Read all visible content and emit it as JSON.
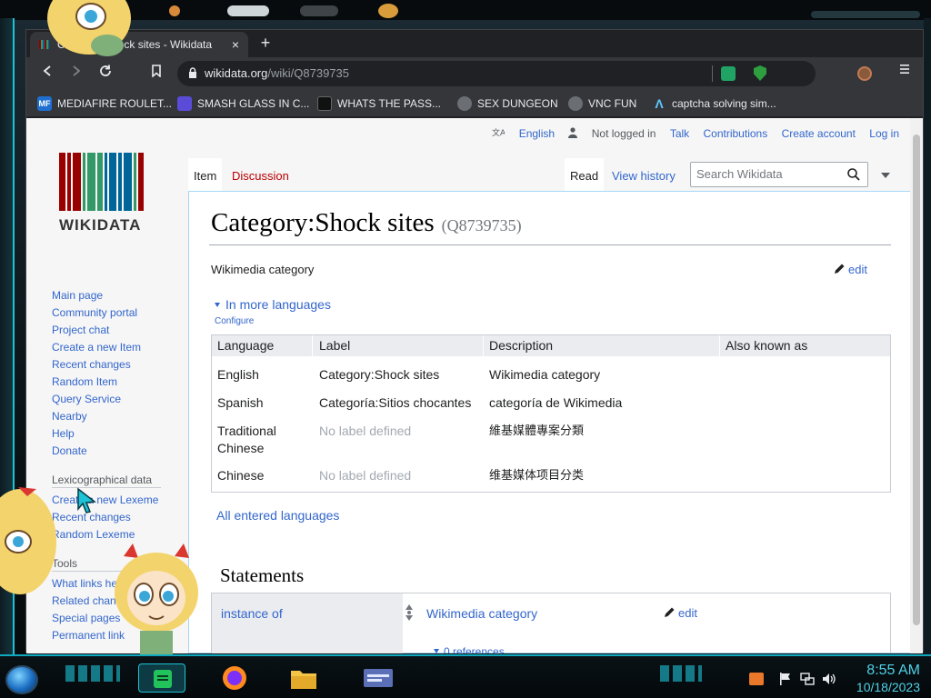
{
  "browser": {
    "tab_title": "Category:Shock sites - Wikidata",
    "new_tab": "+",
    "tab_close": "×",
    "url_host": "wikidata.org",
    "url_path": "/wiki/Q8739735"
  },
  "bookmarks": [
    {
      "label": "MEDIAFIRE ROULET...",
      "icon_text": "MF",
      "color": "#1f6fd1"
    },
    {
      "label": "SMASH GLASS IN C...",
      "icon_text": "",
      "color": "#5b4cd8"
    },
    {
      "label": "WHATS THE PASS...",
      "icon_text": "",
      "color": "#111111"
    },
    {
      "label": "SEX DUNGEON",
      "icon_text": "",
      "color": "#6b6f75"
    },
    {
      "label": "VNC FUN",
      "icon_text": "",
      "color": "#6b6f75"
    },
    {
      "label": "captcha solving sim...",
      "icon_text": "",
      "color": "#35363a"
    }
  ],
  "personal": {
    "language": "English",
    "not_logged_in": "Not logged in",
    "talk": "Talk",
    "contributions": "Contributions",
    "create_account": "Create account",
    "log_in": "Log in"
  },
  "logo": {
    "word": "WIKIDATA"
  },
  "sidebar": {
    "main": [
      "Main page",
      "Community portal",
      "Project chat",
      "Create a new Item",
      "Recent changes",
      "Random Item",
      "Query Service",
      "Nearby",
      "Help",
      "Donate"
    ],
    "lexeme_header": "Lexicographical data",
    "lexeme": [
      "Create a new Lexeme",
      "Recent changes",
      "Random Lexeme"
    ],
    "tools_header": "Tools",
    "tools": [
      "What links here",
      "Related changes",
      "Special pages",
      "Permanent link"
    ]
  },
  "page_tabs": {
    "item": "Item",
    "discussion": "Discussion",
    "read": "Read",
    "view_history": "View history",
    "search_placeholder": "Search Wikidata"
  },
  "entity": {
    "title": "Category:Shock sites",
    "qid": "(Q8739735)",
    "description": "Wikimedia category",
    "edit": "edit",
    "in_more_languages": "In more languages",
    "configure": "Configure",
    "all_languages": "All entered languages"
  },
  "languages": {
    "headers": [
      "Language",
      "Label",
      "Description",
      "Also known as"
    ],
    "rows": [
      {
        "language": "English",
        "label": "Category:Shock sites",
        "label_missing": false,
        "description": "Wikimedia category"
      },
      {
        "language": "Spanish",
        "label": "Categoría:Sitios chocantes",
        "label_missing": false,
        "description": "categoría de Wikimedia"
      },
      {
        "language": "Traditional Chinese",
        "label": "No label defined",
        "label_missing": true,
        "description": "維基媒體專案分類"
      },
      {
        "language": "Chinese",
        "label": "No label defined",
        "label_missing": true,
        "description": "维基媒体项目分类"
      }
    ]
  },
  "statements": {
    "header": "Statements",
    "property": "instance of",
    "value": "Wikimedia category",
    "edit": "edit",
    "references": "0 references"
  },
  "taskbar": {
    "time": "8:55 AM",
    "date": "10/18/2023"
  },
  "colors": {
    "link": "#3366cc",
    "red_link": "#ba0000",
    "accent": "#0fa9be"
  }
}
